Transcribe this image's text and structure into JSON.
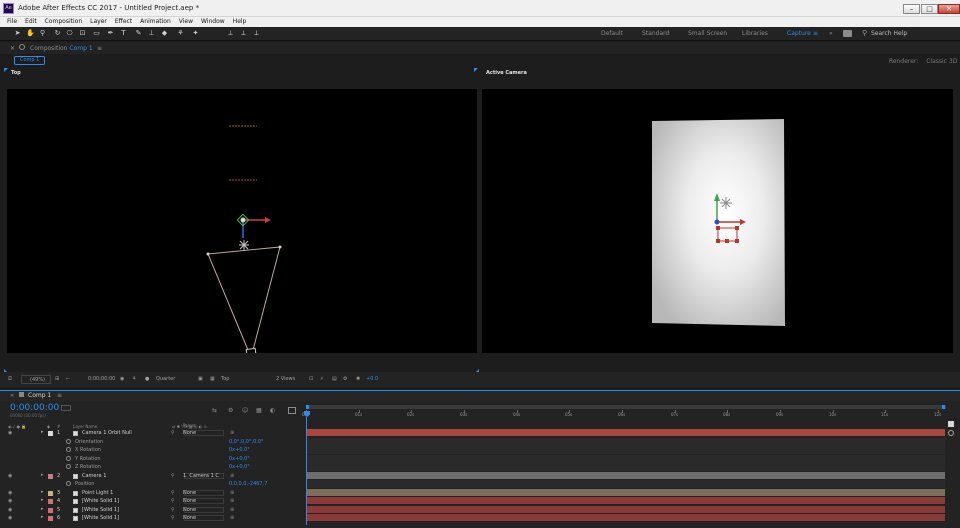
{
  "window": {
    "title": "Adobe After Effects CC 2017 - Untitled Project.aep *",
    "app_icon": "Ae"
  },
  "menu": [
    "File",
    "Edit",
    "Composition",
    "Layer",
    "Effect",
    "Animation",
    "View",
    "Window",
    "Help"
  ],
  "workspaces": [
    "Default",
    "Standard",
    "Small Screen",
    "Libraries",
    "Capture"
  ],
  "workspace_active": "Capture",
  "search_placeholder": "Search Help",
  "composition": {
    "panel_prefix": "Composition",
    "name": "Comp 1",
    "subtab": "Comp 1",
    "renderer_label": "Renderer:",
    "renderer": "Classic 3D"
  },
  "views": {
    "left_label": "Top",
    "right_label": "Active Camera"
  },
  "footer": {
    "zoom": "(49%)",
    "timecode": "0:00:00:00",
    "quality": "Quarter",
    "view": "Top",
    "layout": "2 Views",
    "exposure": "+0.0"
  },
  "timeline": {
    "tab": "Comp 1",
    "timecode": "0:00:00:00",
    "timecode_sub": "00000 (30.00 fps)",
    "columns": {
      "num": "#",
      "layer_name": "Layer Name",
      "parent": "Parent"
    },
    "ruler": [
      "0s",
      "01s",
      "02s",
      "03s",
      "04s",
      "05s",
      "06s",
      "07s",
      "08s",
      "09s",
      "10s",
      "11s",
      "12s"
    ],
    "rows": [
      {
        "kind": "layer",
        "num": "1",
        "name": "Camera 1 Orbit Null",
        "color": "#d8d8d8",
        "parent": "None",
        "bar": "#a8463f"
      },
      {
        "kind": "prop",
        "name": "Orientation",
        "value": "0,0°,0,0°,0,0°"
      },
      {
        "kind": "prop",
        "name": "X Rotation",
        "value": "0x+0,0°"
      },
      {
        "kind": "prop",
        "name": "Y Rotation",
        "value": "0x+0,0°"
      },
      {
        "kind": "prop",
        "name": "Z Rotation",
        "value": "0x+0,0°"
      },
      {
        "kind": "layer",
        "num": "2",
        "name": "Camera 1",
        "color": "#c77f80",
        "parent": "1. Camera 1 C",
        "bar": "#6e6e6e"
      },
      {
        "kind": "prop",
        "name": "Position",
        "value": "0,0,0,0,-2467,7"
      },
      {
        "kind": "layer",
        "num": "3",
        "name": "Point Light 1",
        "color": "#c9b37a",
        "parent": "None",
        "bar": "#7d6f5e"
      },
      {
        "kind": "layer",
        "num": "4",
        "name": "[White Solid 1]",
        "color": "#d07070",
        "parent": "None",
        "bar": "#8a3a38"
      },
      {
        "kind": "layer",
        "num": "5",
        "name": "[White Solid 1]",
        "color": "#d07070",
        "parent": "None",
        "bar": "#8a3a38"
      },
      {
        "kind": "layer",
        "num": "6",
        "name": "[White Solid 1]",
        "color": "#d07070",
        "parent": "None",
        "bar": "#8a3a38"
      }
    ]
  },
  "colors": {
    "accent": "#2d8ceb",
    "panel": "#232323",
    "viewer": "#000000"
  }
}
